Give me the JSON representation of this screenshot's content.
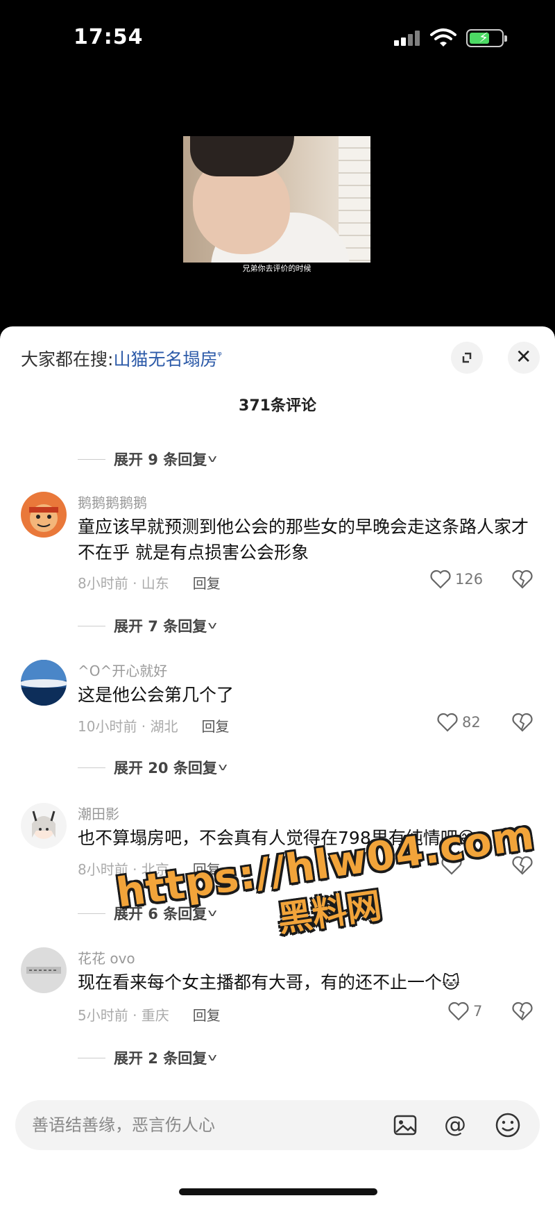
{
  "status": {
    "time": "17:54"
  },
  "video": {
    "caption": "兄弟你去评价的时候"
  },
  "header": {
    "prefix": "大家都在搜:",
    "keyword": "山猫无名塌房"
  },
  "comment_count": "371条评论",
  "expand_rows": [
    "展开 9 条回复",
    "展开 7 条回复",
    "展开 20 条回复",
    "展开 6 条回复",
    "展开 2 条回复"
  ],
  "comments": [
    {
      "user": "鹅鹅鹅鹅鹅",
      "text": "童应该早就预测到他公会的那些女的早晚会走这条路人家才不在乎 就是有点损害公会形象",
      "time": "8小时前 · 山东",
      "reply": "回复",
      "likes": "126"
    },
    {
      "user": "^O^开心就好",
      "text": "这是他公会第几个了",
      "time": "10小时前 · 湖北",
      "reply": "回复",
      "likes": "82"
    },
    {
      "user": "潮田影",
      "text": "也不算塌房吧，不会真有人觉得在798里有纯情吧😅",
      "time": "8小时前 · 北京",
      "reply": "回复",
      "likes": ""
    },
    {
      "user": "花花 ovo",
      "text": "现在看来每个女主播都有大哥，有的还不止一个🐱",
      "time": "5小时前 · 重庆",
      "reply": "回复",
      "likes": "7"
    }
  ],
  "watermark": {
    "url": "https://hlw04.com",
    "name": "黑料网"
  },
  "input": {
    "placeholder": "善语结善缘，恶言伤人心"
  }
}
